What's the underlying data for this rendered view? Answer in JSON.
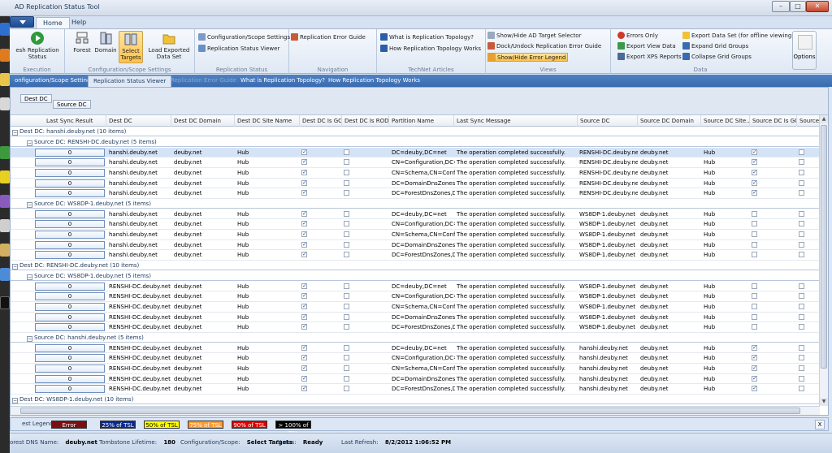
{
  "window": {
    "title": "AD Replication Status Tool"
  },
  "ribbon_tabs": [
    {
      "label": "Home"
    },
    {
      "label": "Help"
    }
  ],
  "ribbon": {
    "execution": {
      "refresh": "esh Replication Status",
      "label": "Execution"
    },
    "scope": {
      "forest": "Forest",
      "domain": "Domain",
      "select_targets": "Select Targets",
      "load_exported": "Load Exported Data Set",
      "label": "Configuration/Scope Settings"
    },
    "replication_status": {
      "config_scope": "Configuration/Scope Settings",
      "repl_viewer": "Replication Status Viewer",
      "label": "Replication Status"
    },
    "navigation": {
      "error_guide": "Replication Error Guide",
      "label": "Navigation"
    },
    "technet": {
      "what_is": "What is Replication Topology?",
      "how_works": "How Replication Topology Works",
      "label": "TechNet Articles"
    },
    "views": {
      "show_hide_target": "Show/Hide AD Target Selector",
      "dock_undock": "Dock/Undock Replication Error Guide",
      "show_hide_legend": "Show/Hide Error Legend",
      "label": "Views"
    },
    "data": {
      "errors_only": "Errors Only",
      "export_view": "Export View Data",
      "export_xps": "Export XPS Reports",
      "export_dataset": "Export Data Set (for offline viewing)",
      "expand": "Expand Grid Groups",
      "collapse": "Collapse Grid Groups",
      "label": "Data"
    },
    "options": "Options"
  },
  "doc_tabs": [
    {
      "label": "onfiguration/Scope Settings"
    },
    {
      "label": "Replication Status Viewer"
    },
    {
      "label": "Replication Error Guide"
    },
    {
      "label": "What is Replication Topology?"
    },
    {
      "label": "How Replication Topology Works"
    }
  ],
  "group_chips": {
    "dest": "Dest DC",
    "source": "Source DC"
  },
  "columns": [
    "Last Sync Result",
    "Dest DC",
    "Dest DC Domain",
    "Dest DC Site Name",
    "Dest DC Is GC?",
    "Dest DC Is RODC?",
    "Partition Name",
    "Last Sync Message",
    "Source DC",
    "Source DC Domain",
    "Source DC Site...",
    "Source DC Is GC?",
    "Source DC I"
  ],
  "groups": [
    {
      "label": "Dest DC: hanshi.deuby.net (10 items)",
      "sub": [
        {
          "label": "Source DC: RENSHI-DC.deuby.net (5 items)",
          "dest": "hanshi.deuby.net",
          "source": "RENSHI-DC.deuby.net",
          "sgc": true
        },
        {
          "label": "Source DC: WS8DP-1.deuby.net (5 items)",
          "dest": "hanshi.deuby.net",
          "source": "WS8DP-1.deuby.net",
          "sgc": false
        }
      ]
    },
    {
      "label": "Dest DC: RENSHI-DC.deuby.net (10 items)",
      "sub": [
        {
          "label": "Source DC: WS8DP-1.deuby.net (5 items)",
          "dest": "RENSHI-DC.deuby.net",
          "source": "WS8DP-1.deuby.net",
          "sgc": false
        },
        {
          "label": "Source DC: hanshi.deuby.net (5 items)",
          "dest": "RENSHI-DC.deuby.net",
          "source": "hanshi.deuby.net",
          "sgc": true
        }
      ]
    },
    {
      "label": "Dest DC: WS8DP-1.deuby.net (10 items)",
      "sub": []
    }
  ],
  "row_common": {
    "result": "0",
    "domain": "deuby.net",
    "site": "Hub",
    "message": "The operation completed successfully.",
    "partitions": [
      "DC=deuby,DC=net",
      "CN=Configuration,DC=...",
      "CN=Schema,CN=Config...",
      "DC=DomainDnsZones,...",
      "DC=ForestDnsZones,D..."
    ]
  },
  "legend": {
    "label": "est Legend:",
    "items": [
      {
        "text": "Error",
        "bg": "#7b0f0f",
        "fg": "#ffffff"
      },
      {
        "text": "25% of TSL",
        "bg": "#0a2a8c",
        "fg": "#ffffff"
      },
      {
        "text": "50% of TSL",
        "bg": "#ffff00",
        "fg": "#000000"
      },
      {
        "text": "75% of TSL",
        "bg": "#ff9a2e",
        "fg": "#ffffff"
      },
      {
        "text": "90% of TSL",
        "bg": "#e00000",
        "fg": "#ffffff"
      },
      {
        "text": "> 100% of TSL",
        "bg": "#000000",
        "fg": "#ffffff"
      }
    ],
    "close": "X"
  },
  "status": {
    "forest_label": "orest DNS Name:",
    "forest": "deuby.net",
    "tombstone_label": "Tombstone Lifetime:",
    "tombstone": "180",
    "scope_label": "Configuration/Scope:",
    "scope": "Select Targets",
    "status_label": "Status:",
    "status": "Ready",
    "refresh_label": "Last Refresh:",
    "refresh": "8/2/2012 1:06:52 PM"
  }
}
